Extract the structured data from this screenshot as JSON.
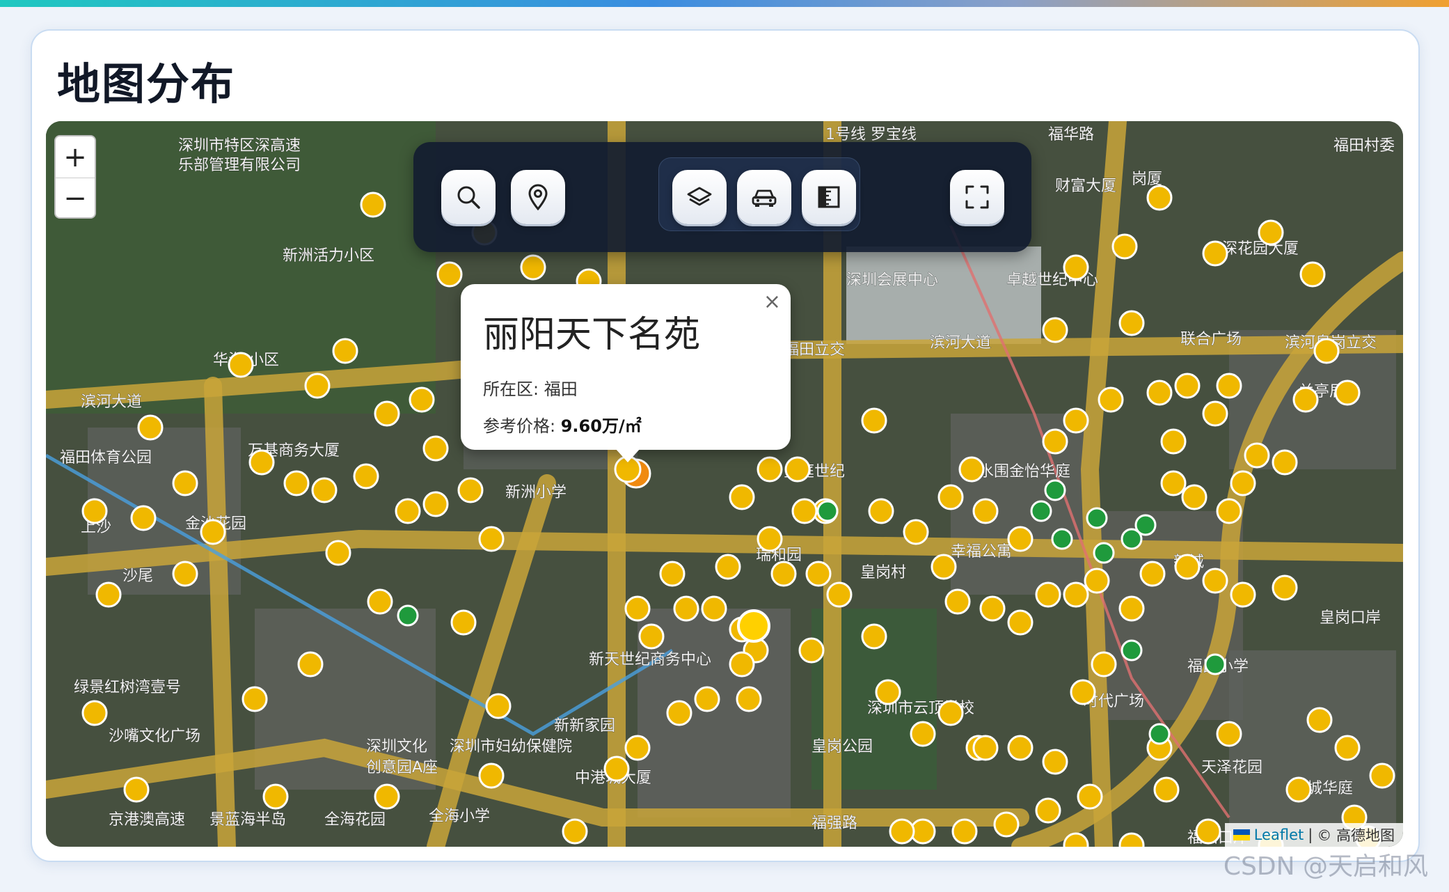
{
  "page": {
    "title": "地图分布"
  },
  "zoom": {
    "in_label": "+",
    "out_label": "−"
  },
  "toolbar": {
    "buttons": [
      {
        "name": "search-button",
        "icon": "search-icon"
      },
      {
        "name": "locate-button",
        "icon": "map-pin-icon"
      },
      {
        "name": "layers-button",
        "icon": "layers-icon"
      },
      {
        "name": "traffic-button",
        "icon": "car-icon"
      },
      {
        "name": "measure-button",
        "icon": "ruler-icon"
      },
      {
        "name": "fullscreen-button",
        "icon": "fullscreen-icon"
      }
    ]
  },
  "popup": {
    "title": "丽阳天下名苑",
    "district_label": "所在区:",
    "district": "福田",
    "price_label": "参考价格:",
    "price": "9.60万/㎡",
    "close": "×"
  },
  "attribution": {
    "leaflet": "Leaflet",
    "separator": "|",
    "provider": "© 高德地图"
  },
  "watermark": "CSDN @天启和风",
  "map_labels": [
    "深圳市特区深高速",
    "乐部管理有限公司",
    "新洲活力小区",
    "滨河大道",
    "福田体育公园",
    "万基商务大厦",
    "华海·小区",
    "金沙花园",
    "上沙",
    "沙尾",
    "绿景红树湾壹号",
    "沙嘴文化广场",
    "景蓝海半岛",
    "全海花园",
    "全海小学",
    "京港澳高速",
    "深圳文化",
    "创意园A座",
    "深圳市妇幼保健院",
    "新新家园",
    "中港城大厦",
    "新天世纪商务中心",
    "新洲小学",
    "皇庭世纪",
    "瑞和园",
    "皇岗村",
    "皇岗公园",
    "深圳会展中心",
    "卓越世纪中心",
    "滨河大道",
    "福田立交",
    "水围金怡华庭",
    "幸福公寓",
    "深圳市云顶学校",
    "时代广场",
    "福民小学",
    "天泽花园",
    "港城华庭",
    "新城",
    "福强路",
    "福田口岸",
    "滨河皇岗立交",
    "联合广场",
    "深花园大厦",
    "兰亭居",
    "皇岗口岸",
    "福田村委",
    "财富大厦",
    "岗厦",
    "1号线 罗宝线",
    "福华路"
  ],
  "colors": {
    "marker_yellow": "#f0b800",
    "marker_green": "#1f9a3c",
    "marker_orange": "#f08a10",
    "road": "#c9a43a"
  }
}
